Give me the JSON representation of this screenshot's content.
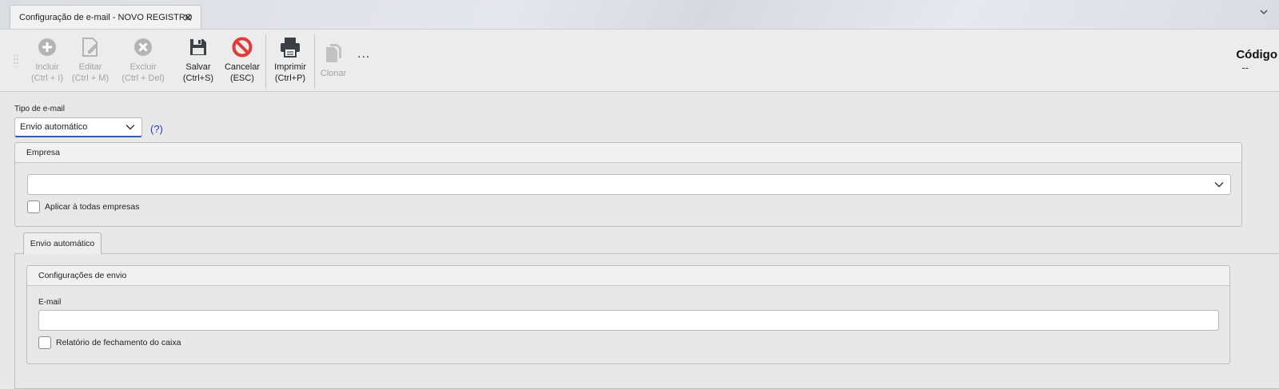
{
  "tab": {
    "title": "Configuração de e-mail - NOVO REGISTRO",
    "close": "✕",
    "menu": "⌄"
  },
  "toolbar": {
    "incluir": {
      "line1": "Incluir",
      "line2": "(Ctrl + I)"
    },
    "editar": {
      "line1": "Editar",
      "line2": "(Ctrl + M)"
    },
    "excluir": {
      "line1": "Excluir",
      "line2": "(Ctrl + Del)"
    },
    "salvar": {
      "line1": "Salvar",
      "line2": "(Ctrl+S)"
    },
    "cancelar": {
      "line1": "Cancelar",
      "line2": "(ESC)"
    },
    "imprimir": {
      "line1": "Imprimir",
      "line2": "(Ctrl+P)"
    },
    "clonar": {
      "line1": "Clonar"
    },
    "more": "...",
    "codigo_label": "Código",
    "codigo_value": "--"
  },
  "form": {
    "tipo_label": "Tipo de e-mail",
    "tipo_value": "Envio automático",
    "help": "(?)",
    "empresa": {
      "header": "Empresa",
      "value": "",
      "aplicar_todas_label": "Aplicar à todas empresas",
      "aplicar_todas_checked": false
    },
    "tabs": [
      {
        "label": "Envio automático",
        "active": true
      }
    ],
    "config_envio": {
      "header": "Configurações de envio",
      "email_label": "E-mail",
      "email_value": "",
      "relatorio_label": "Relatório de fechamento do caixa",
      "relatorio_checked": false
    }
  },
  "colors": {
    "cancel_red": "#e23a3a",
    "disabled_gray": "#a3a3a3",
    "link_blue": "#1f3fbf"
  }
}
